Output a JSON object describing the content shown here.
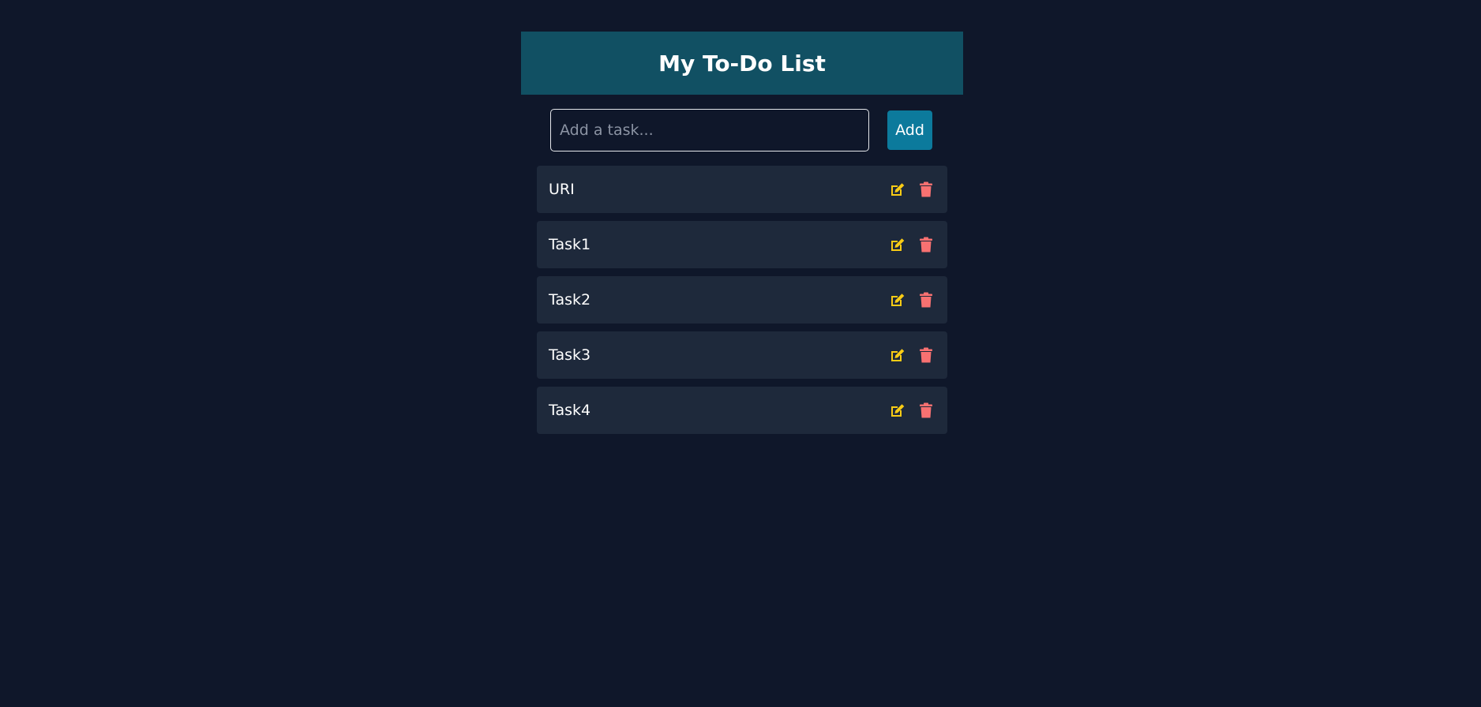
{
  "header": {
    "title": "My To-Do List"
  },
  "form": {
    "input_placeholder": "Add a task...",
    "input_value": "",
    "add_label": "Add"
  },
  "tasks": [
    {
      "text": "URI",
      "edit_icon": "edit-icon",
      "delete_icon": "trash-icon"
    },
    {
      "text": "Task1",
      "edit_icon": "edit-icon",
      "delete_icon": "trash-icon"
    },
    {
      "text": "Task2",
      "edit_icon": "edit-icon",
      "delete_icon": "trash-icon"
    },
    {
      "text": "Task3",
      "edit_icon": "edit-icon",
      "delete_icon": "trash-icon"
    },
    {
      "text": "Task4",
      "edit_icon": "edit-icon",
      "delete_icon": "trash-icon"
    }
  ],
  "colors": {
    "background": "#0f172a",
    "header": "#115063",
    "task_bg": "#1e293b",
    "add_button": "#0c7a9c",
    "edit_icon": "#facc15",
    "delete_icon": "#f87171"
  }
}
